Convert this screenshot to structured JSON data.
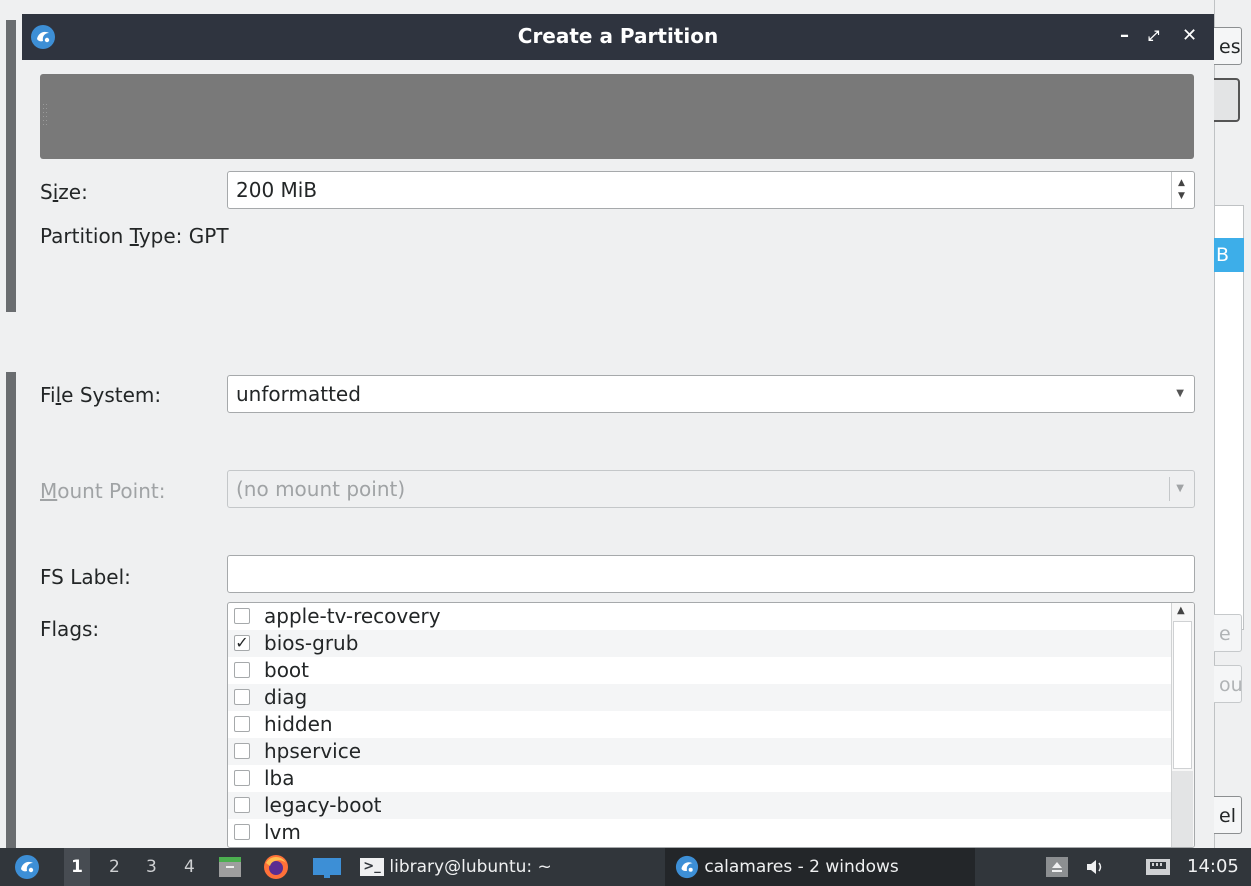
{
  "dialog": {
    "title": "Create a Partition",
    "controls": {
      "minimize": "–",
      "restore": "⤢",
      "close": "✕"
    }
  },
  "form": {
    "size": {
      "label_pre": "S",
      "label_u": "i",
      "label_post": "ze:",
      "value": "200 MiB"
    },
    "partition_type": {
      "label_pre": "Partition ",
      "label_u": "T",
      "label_post": "ype:",
      "value": "GPT"
    },
    "file_system": {
      "label_pre": "Fi",
      "label_u": "l",
      "label_post": "e System:",
      "value": "unformatted"
    },
    "mount_point": {
      "label_pre": "",
      "label_u": "M",
      "label_post": "ount Point:",
      "value": "(no mount point)"
    },
    "fs_label": {
      "label": "FS Label:",
      "value": ""
    },
    "flags": {
      "label": "Flags:",
      "items": [
        {
          "name": "apple-tv-recovery",
          "checked": false
        },
        {
          "name": "bios-grub",
          "checked": true
        },
        {
          "name": "boot",
          "checked": false
        },
        {
          "name": "diag",
          "checked": false
        },
        {
          "name": "hidden",
          "checked": false
        },
        {
          "name": "hpservice",
          "checked": false
        },
        {
          "name": "lba",
          "checked": false
        },
        {
          "name": "legacy-boot",
          "checked": false
        },
        {
          "name": "lvm",
          "checked": false
        }
      ]
    }
  },
  "background_window": {
    "btn_top": "es",
    "list_selected": "B",
    "btn_mid1": "e",
    "btn_mid2": "ou",
    "btn_bottom": "el"
  },
  "taskbar": {
    "workspaces": [
      "1",
      "2",
      "3",
      "4"
    ],
    "active_workspace": "1",
    "tasks": [
      {
        "label": "library@lubuntu: ~"
      },
      {
        "label": "calamares - 2 windows"
      }
    ],
    "clock": "14:05"
  },
  "colors": {
    "titlebar": "#2f343f",
    "partition_bar": "#797979",
    "taskbar": "#31363b",
    "selection": "#3daee9"
  }
}
